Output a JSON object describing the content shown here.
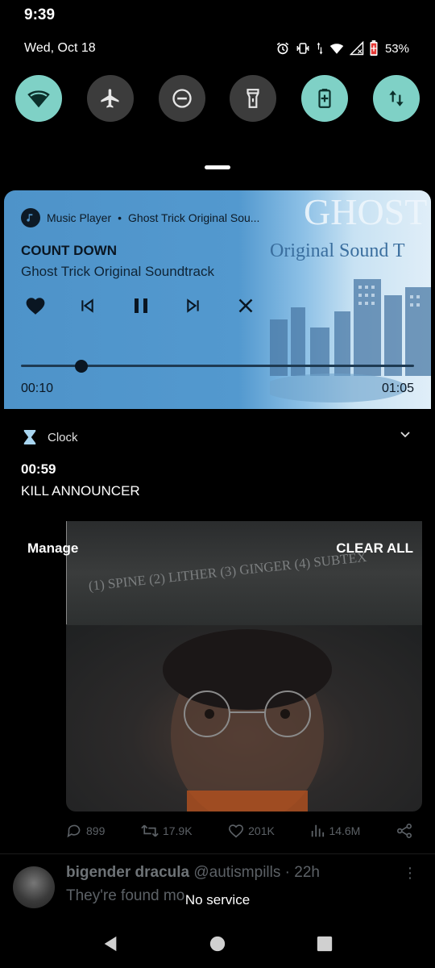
{
  "status_bar": {
    "time": "9:39",
    "date": "Wed, Oct 18",
    "battery": "53%",
    "icons": [
      "alarm-icon",
      "vibrate-icon",
      "data-arrows-icon",
      "wifi-icon",
      "signal-icon",
      "battery-icon"
    ]
  },
  "quick_settings": [
    {
      "name": "wifi-tile",
      "icon": "wifi-icon",
      "on": true
    },
    {
      "name": "airplane-tile",
      "icon": "airplane-icon",
      "on": false
    },
    {
      "name": "dnd-tile",
      "icon": "do-not-disturb-icon",
      "on": false
    },
    {
      "name": "flashlight-tile",
      "icon": "flashlight-icon",
      "on": false
    },
    {
      "name": "battery-saver-tile",
      "icon": "battery-saver-icon",
      "on": true
    },
    {
      "name": "mobile-data-tile",
      "icon": "mobile-data-icon",
      "on": true
    }
  ],
  "media": {
    "app": "Music Player",
    "source": "Ghost Trick Original Sou...",
    "title": "COUNT DOWN",
    "album": "Ghost Trick Original Soundtrack",
    "elapsed": "00:10",
    "duration": "01:05",
    "progress": 0.154,
    "controls": [
      "heart-icon",
      "skip-previous-icon",
      "pause-icon",
      "skip-next-icon",
      "close-icon"
    ],
    "art_text_1": "GHOST T",
    "art_text_2": "Original Sound T"
  },
  "clock_notification": {
    "app": "Clock",
    "timer": "00:59",
    "label": "KILL ANNOUNCER"
  },
  "shade_actions": {
    "manage": "Manage",
    "clear_all": "CLEAR ALL"
  },
  "background_app": {
    "quiz_text": "(1) SPINE (2) LITHER (3) GINGER (4) SUBTEX",
    "replies": "899",
    "retweets": "17.9K",
    "likes": "201K",
    "views": "14.6M",
    "author": "bigender dracula",
    "handle": "@autismpills · 22h",
    "tweet_text": "They're found mo"
  },
  "network_status": "No service"
}
